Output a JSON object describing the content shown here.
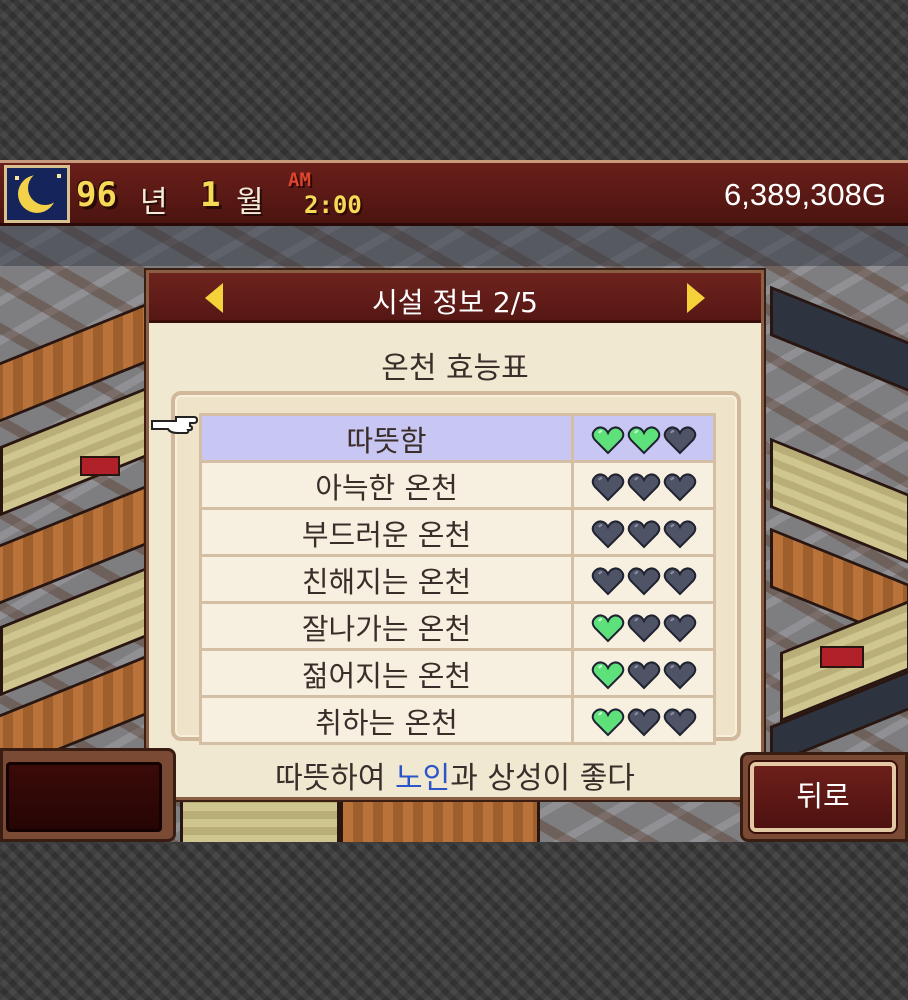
{
  "status_bar": {
    "year": "96",
    "year_unit": "년",
    "month": "1",
    "month_unit": "월",
    "ampm": "AM",
    "time": "2:00",
    "money": "6,389,308G",
    "time_of_day_icon": "crescent-moon-icon"
  },
  "dialog": {
    "header_title": "시설 정보 2/5",
    "subtitle": "온천 효능표",
    "rows": [
      {
        "name": "따뜻함",
        "hearts": [
          true,
          true,
          false
        ],
        "selected": true
      },
      {
        "name": "아늑한 온천",
        "hearts": [
          false,
          false,
          false
        ],
        "selected": false
      },
      {
        "name": "부드러운 온천",
        "hearts": [
          false,
          false,
          false
        ],
        "selected": false
      },
      {
        "name": "친해지는 온천",
        "hearts": [
          false,
          false,
          false
        ],
        "selected": false
      },
      {
        "name": "잘나가는 온천",
        "hearts": [
          true,
          false,
          false
        ],
        "selected": false
      },
      {
        "name": "젊어지는 온천",
        "hearts": [
          true,
          false,
          false
        ],
        "selected": false
      },
      {
        "name": "취하는 온천",
        "hearts": [
          true,
          false,
          false
        ],
        "selected": false
      }
    ],
    "description": {
      "before": "따뜻하여 ",
      "highlight": "노인",
      "after": "과 상성이 좋다"
    }
  },
  "buttons": {
    "back_label": "뒤로"
  },
  "colors": {
    "heart_on": "#5ee07a",
    "heart_off": "#4f5366",
    "highlight_text": "#2a56c8",
    "selected_row": "#c8c6f2"
  }
}
